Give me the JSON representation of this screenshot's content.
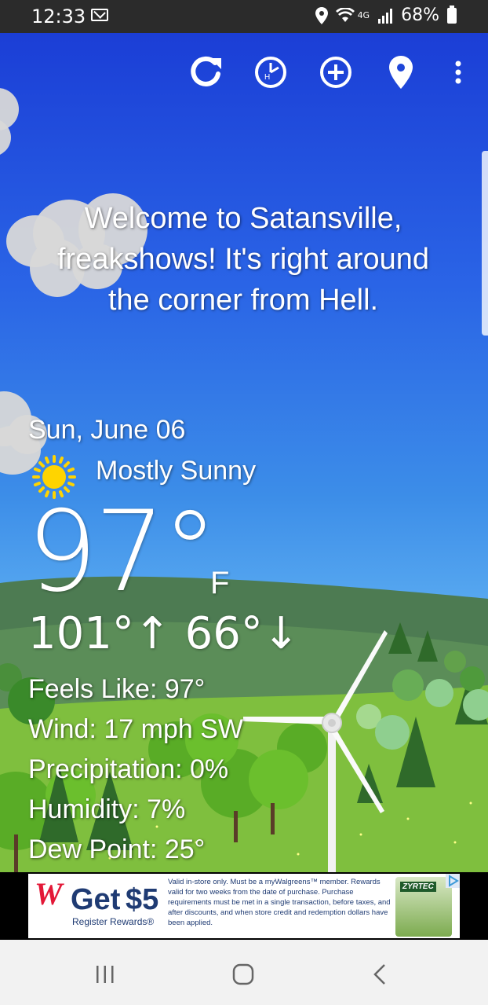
{
  "status": {
    "time": "12:33",
    "network": "4G",
    "battery": "68%"
  },
  "toolbar": {
    "icons": [
      "refresh-icon",
      "clock-hourly-icon",
      "add-location-icon",
      "location-pin-icon",
      "more-vert-icon"
    ]
  },
  "message": "Welcome to Satansville, freakshows! It's right around the corner from Hell.",
  "weather": {
    "date": "Sun, June 06",
    "condition": "Mostly Sunny",
    "temp": "97°",
    "unit": "F",
    "high": "101°",
    "low": "66°",
    "feels_like": "Feels Like: 97°",
    "wind": "Wind: 17 mph SW",
    "precipitation": "Precipitation: 0%",
    "humidity": "Humidity: 7%",
    "dew_point": "Dew Point: 25°"
  },
  "ad": {
    "brand": "W",
    "headline": "Get",
    "amount": "$5",
    "sub": "Register Rewards®",
    "fineprint": "Valid in-store only. Must be a myWalgreens™ member. Rewards valid for two weeks from the date of purchase. Purchase requirements must be met in a single transaction, before taxes, and after discounts, and when store credit and redemption dollars have been applied.",
    "product": "ZYRTEC"
  },
  "colors": {
    "sky_top": "#1b3ed6",
    "hill": "#4d7b52",
    "grass": "#7fbf3e",
    "brand_red": "#e31837"
  }
}
